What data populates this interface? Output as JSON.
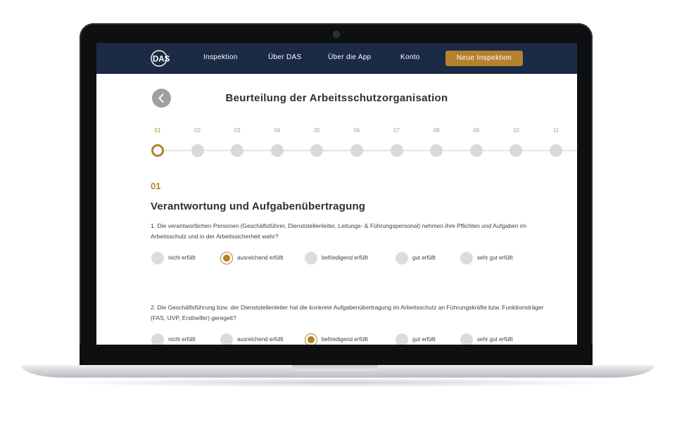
{
  "nav": {
    "logo_text": "DAS",
    "links": [
      "Inspektion",
      "Über DAS",
      "Über die App",
      "Konto"
    ],
    "cta": "Neue Inspektion"
  },
  "page": {
    "title": "Beurteilung der Arbeitsschutzorganisation"
  },
  "stepper": {
    "steps": [
      "01",
      "02",
      "03",
      "04",
      "05",
      "06",
      "07",
      "08",
      "09",
      "10",
      "11"
    ],
    "active_index": 0
  },
  "section": {
    "number": "01",
    "title": "Verantwortung und Aufgabenübertragung"
  },
  "options": [
    "nicht erfüllt",
    "ausreichend erfüllt",
    "befriedigend erfüllt",
    "gut erfüllt",
    "sehr gut erfüllt"
  ],
  "questions": [
    {
      "text": "1. Die verantwortlichen Personen (Geschäftsführer, Dienststellenleiter, Leitungs- & Führungspersonal) nehmen ihre Pflichten und Aufgaben im Arbeitsschutz und in der Arbeitssicherheit wahr?",
      "selected": "ausreichend erfüllt"
    },
    {
      "text": "2. Die Geschäftsführung bzw. der Dienststellenleiter hat die konkrete Aufgabenübertragung im Arbeitsschutz an Führungskräfte bzw. Funktionsträger (FAS, UVP, Ersthelfer) geregelt?",
      "selected": "befriedigend erfüllt"
    }
  ],
  "colors": {
    "navbar": "#1b2a45",
    "accent": "#b5812e",
    "inactive": "#d8d9db"
  },
  "icons": {
    "back": "chevron-left-icon",
    "logo": "das-logo-icon"
  }
}
